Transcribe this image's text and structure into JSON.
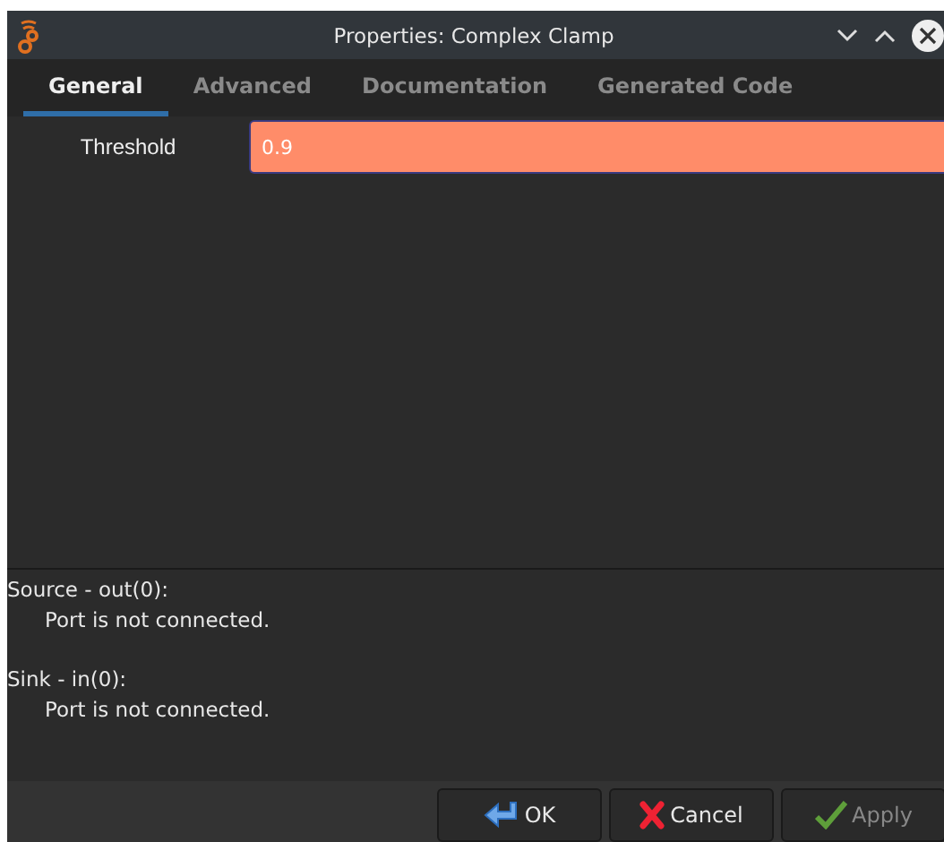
{
  "window": {
    "title": "Properties: Complex Clamp"
  },
  "tabs": [
    {
      "label": "General",
      "selected": true
    },
    {
      "label": "Advanced",
      "selected": false
    },
    {
      "label": "Documentation",
      "selected": false
    },
    {
      "label": "Generated Code",
      "selected": false
    }
  ],
  "params": [
    {
      "label": "Threshold",
      "value": "0.9"
    }
  ],
  "ports": [
    {
      "name": "Source - out(0):",
      "status": "Port is not connected."
    },
    {
      "name": "Sink - in(0):",
      "status": "Port is not connected."
    }
  ],
  "buttons": [
    {
      "kind": "ok",
      "label": "OK",
      "disabled": false
    },
    {
      "kind": "cancel",
      "label": "Cancel",
      "disabled": false
    },
    {
      "kind": "apply",
      "label": "Apply",
      "disabled": true
    }
  ]
}
